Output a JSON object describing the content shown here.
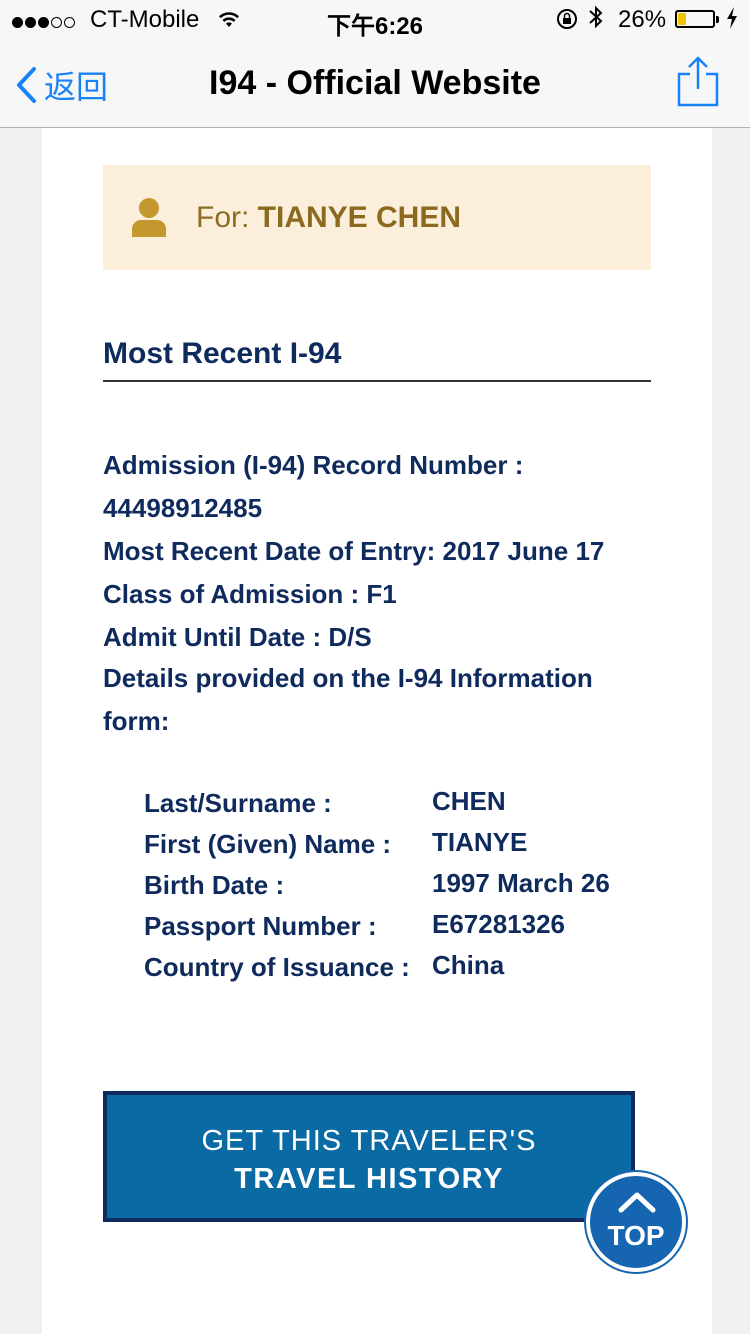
{
  "status_bar": {
    "carrier": "CT-Mobile",
    "time": "下午6:26",
    "battery_percent": "26%",
    "battery_level": 0.26
  },
  "nav": {
    "back_label": "返回",
    "title": "I94 - Official Website"
  },
  "banner": {
    "prefix": "For: ",
    "name": "TIANYE CHEN"
  },
  "section_title": "Most Recent I-94",
  "details": {
    "record_label": "Admission (I-94) Record Number :",
    "record_number": "44498912485",
    "entry_date": "Most Recent Date of Entry: 2017 June 17",
    "class_of_admission": "Class of Admission : F1",
    "admit_until": "Admit Until Date : D/S",
    "details_note_line1": "Details provided on the I-94 Information",
    "details_note_line2": "form:"
  },
  "info": [
    {
      "label": "Last/Surname :",
      "value": "CHEN"
    },
    {
      "label": "First (Given) Name :",
      "value": "TIANYE"
    },
    {
      "label": "Birth Date :",
      "value": "1997 March 26"
    },
    {
      "label": "Passport Number :",
      "value": "E67281326"
    },
    {
      "label": "Country of Issuance :",
      "value": "China"
    }
  ],
  "history_button": {
    "line1": "GET THIS TRAVELER'S",
    "line2": "TRAVEL HISTORY"
  },
  "top_button": {
    "label": "TOP"
  },
  "colors": {
    "navy": "#0f2a5c",
    "button_blue": "#0a6aa3",
    "banner_bg": "#fbefdc",
    "banner_gold": "#8b6a1f",
    "ios_blue": "#1a82f7"
  }
}
